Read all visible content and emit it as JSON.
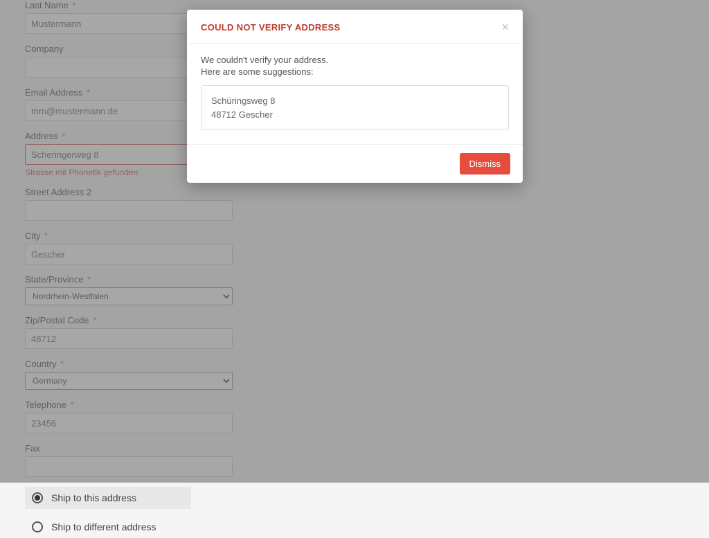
{
  "form": {
    "last_name_label": "Last Name",
    "last_name_value": "Mustermann",
    "company_label": "Company",
    "company_value": "",
    "email_label": "Email Address",
    "email_value": "mm@mustermann.de",
    "address_label": "Address",
    "address_value": "Scheringerweg 8",
    "address_error": "Strasse mit Phonetik gefunden",
    "street2_label": "Street Address 2",
    "street2_value": "",
    "city_label": "City",
    "city_value": "Gescher",
    "state_label": "State/Province",
    "state_value": "Nordrhein-Westfalen",
    "zip_label": "Zip/Postal Code",
    "zip_value": "48712",
    "country_label": "Country",
    "country_value": "Germany",
    "telephone_label": "Telephone",
    "telephone_value": "23456",
    "fax_label": "Fax",
    "fax_value": "",
    "ship_this": "Ship to this address",
    "ship_diff": "Ship to different address"
  },
  "modal": {
    "title": "COULD NOT VERIFY ADDRESS",
    "msg1": "We couldn't verify your address.",
    "msg2": "Here are some suggestions:",
    "suggestion_line1": "Schüringsweg 8",
    "suggestion_line2": "48712 Gescher",
    "dismiss": "Dismiss"
  }
}
